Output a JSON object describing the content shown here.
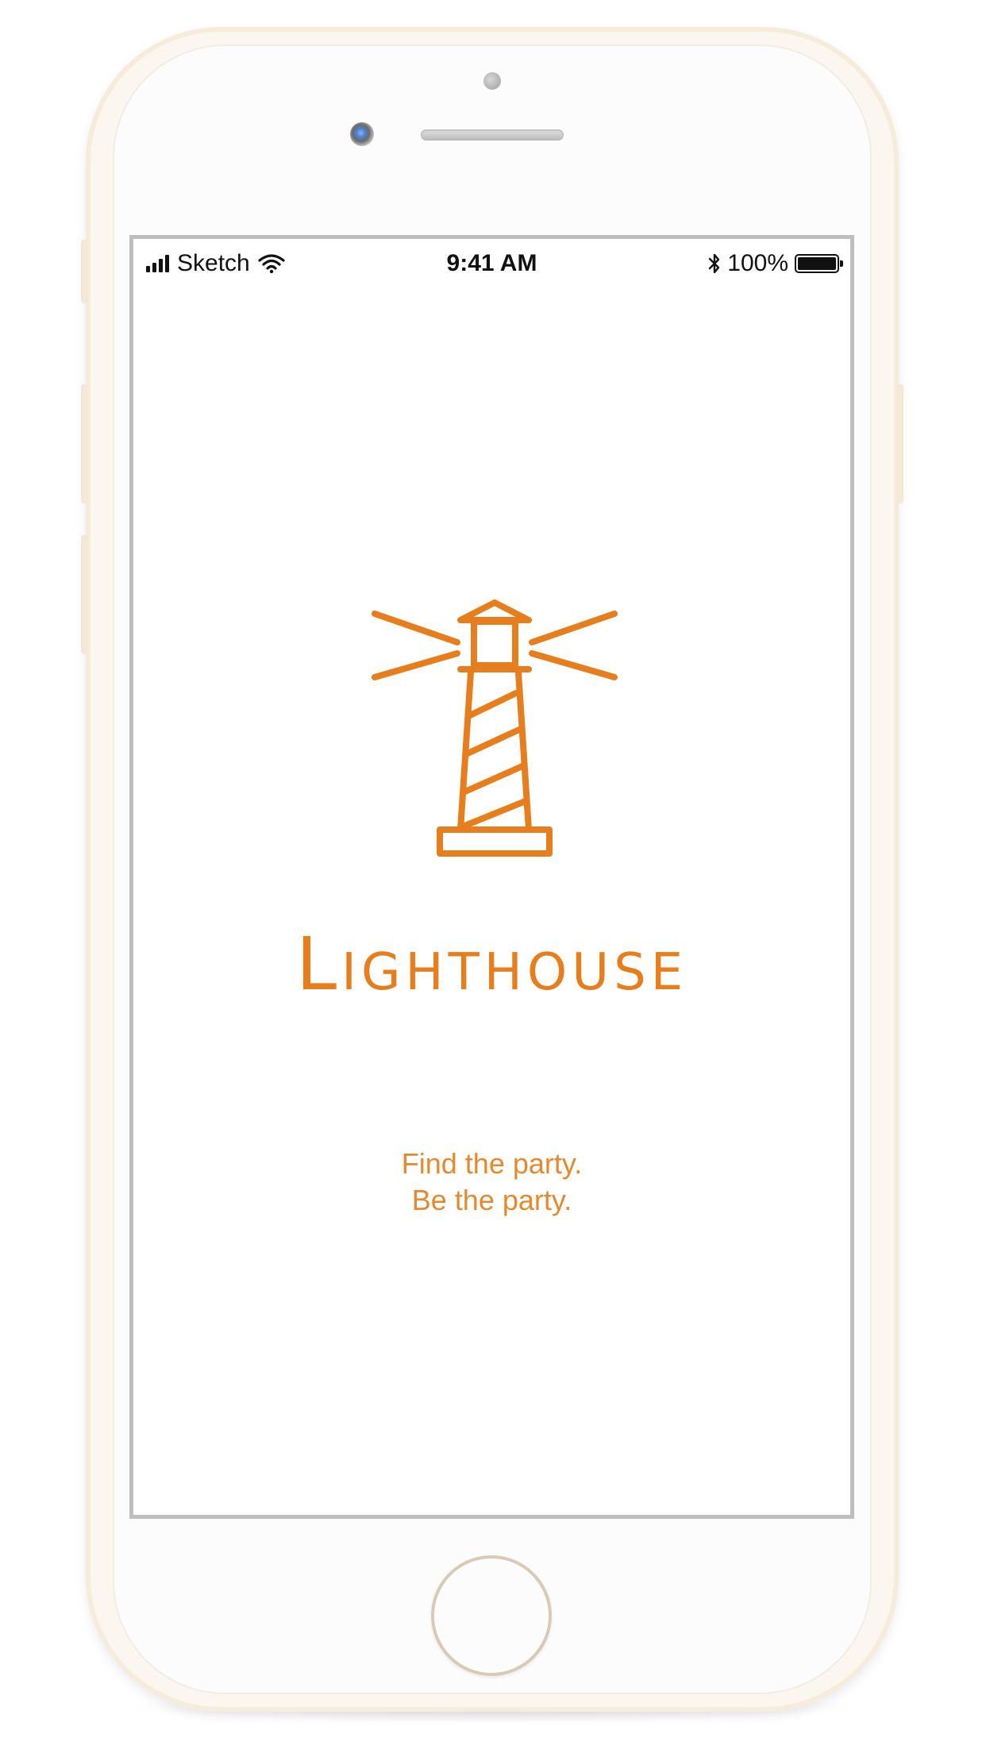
{
  "status_bar": {
    "carrier": "Sketch",
    "time": "9:41 AM",
    "battery_percent": "100%",
    "battery_level": 1.0,
    "icons": [
      "signal-icon",
      "wifi-icon",
      "bluetooth-icon",
      "battery-icon"
    ]
  },
  "app": {
    "name": "Lighthouse",
    "tagline_line1": "Find the party.",
    "tagline_line2": "Be the party.",
    "logo_icon": "lighthouse-icon"
  },
  "colors": {
    "accent": "#e67e1e",
    "tagline": "#e38a31"
  }
}
